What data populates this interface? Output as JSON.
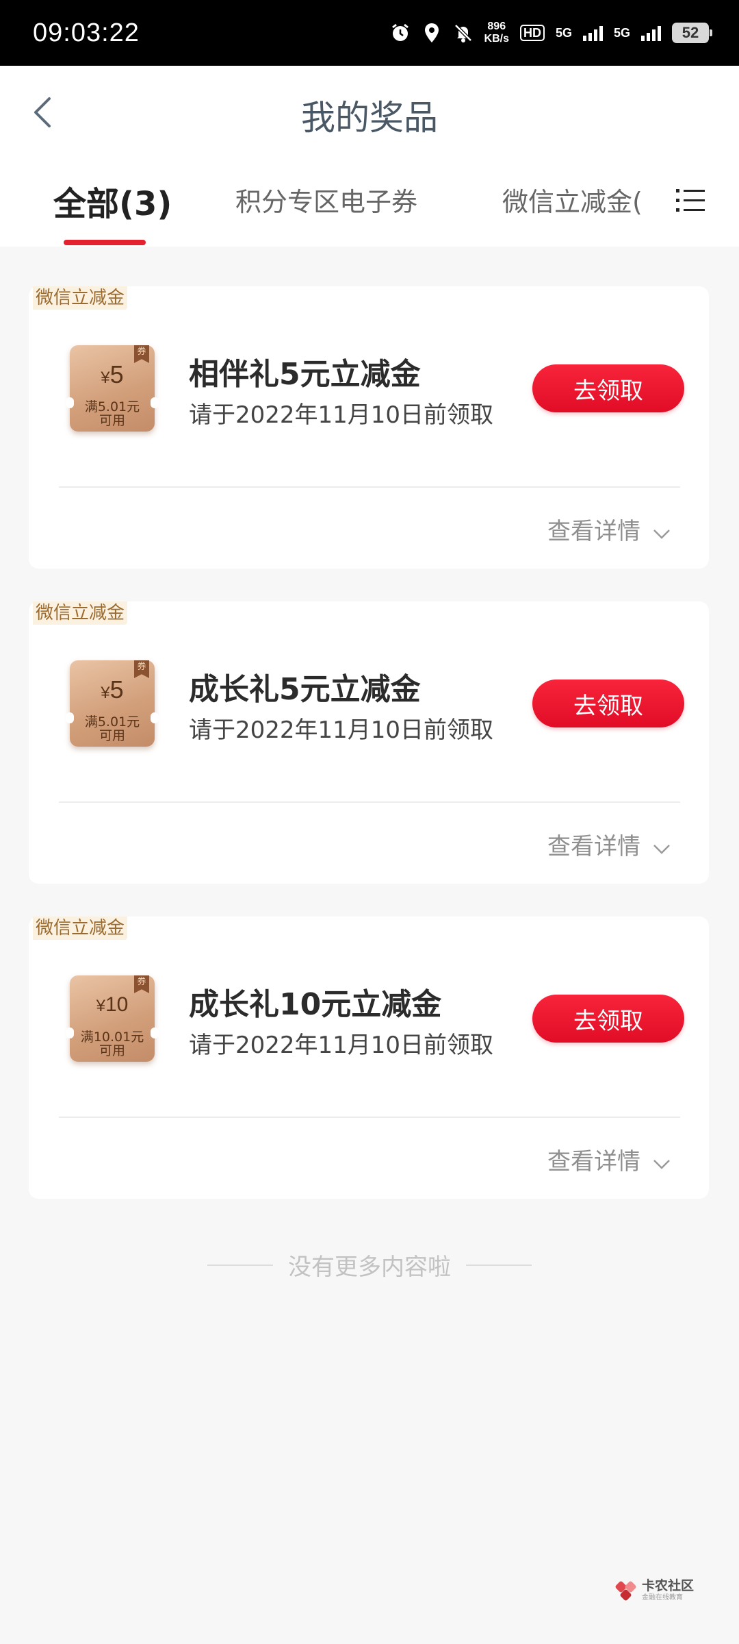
{
  "status_bar": {
    "time": "09:03:22",
    "speed_value": "896",
    "speed_unit": "KB/s",
    "hd_label": "HD",
    "network_1": "5G",
    "network_2": "5G",
    "battery": "52",
    "icons": [
      "alarm-icon",
      "location-icon",
      "bell-muted-icon",
      "hd-icon",
      "signal-icon",
      "signal-icon",
      "battery-icon"
    ]
  },
  "header": {
    "title": "我的奖品"
  },
  "tabs": [
    {
      "label": "全部(3)",
      "active": true
    },
    {
      "label": "积分专区电子券",
      "active": false
    },
    {
      "label": "微信立减金(",
      "active": false
    }
  ],
  "colors": {
    "accent": "#e4212f",
    "button": "#f3172f",
    "coupon": "#d3a07c"
  },
  "prizes": [
    {
      "tag": "微信立减金",
      "coupon_symbol": "¥",
      "coupon_amount": "5",
      "coupon_condition": "满5.01元",
      "coupon_usable": "可用",
      "coupon_badge": "券",
      "title": "相伴礼5元立减金",
      "expiry": "请于2022年11月10日前领取",
      "button": "去领取",
      "details": "查看详情"
    },
    {
      "tag": "微信立减金",
      "coupon_symbol": "¥",
      "coupon_amount": "5",
      "coupon_condition": "满5.01元",
      "coupon_usable": "可用",
      "coupon_badge": "券",
      "title": "成长礼5元立减金",
      "expiry": "请于2022年11月10日前领取",
      "button": "去领取",
      "details": "查看详情"
    },
    {
      "tag": "微信立减金",
      "coupon_symbol": "¥",
      "coupon_amount": "10",
      "coupon_condition": "满10.01元",
      "coupon_usable": "可用",
      "coupon_badge": "券",
      "title": "成长礼10元立减金",
      "expiry": "请于2022年11月10日前领取",
      "button": "去领取",
      "details": "查看详情"
    }
  ],
  "end_note": "没有更多内容啦",
  "watermark": {
    "main": "卡农社区",
    "sub": "金融在线教育"
  }
}
